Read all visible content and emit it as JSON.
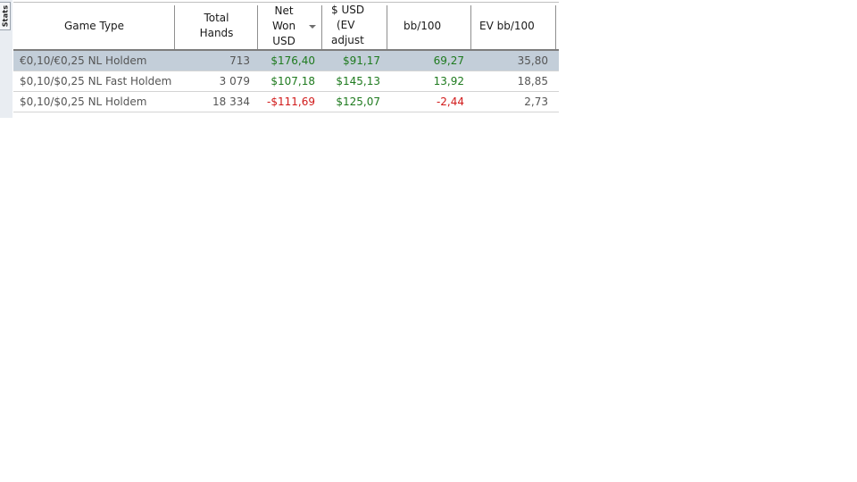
{
  "side_tab": {
    "label": "Stats"
  },
  "columns": {
    "game_type": "Game Type",
    "total_hands_line1": "Total",
    "total_hands_line2": "Hands",
    "net_won_line1": "Net",
    "net_won_line2": "Won",
    "net_won_line3": "USD",
    "usd_ev_line1": "$ USD",
    "usd_ev_line2": "(EV",
    "usd_ev_line3": "adjust",
    "bb100": "bb/100",
    "ev_bb100": "EV bb/100"
  },
  "sort": {
    "column": "net_won",
    "direction": "descending",
    "icon": "sort-down-icon"
  },
  "rows": [
    {
      "game_type": "€0,10/€0,25 NL Holdem",
      "total_hands": "713",
      "net_won": "$176,40",
      "usd_ev": "$91,17",
      "bb100": "69,27",
      "ev_bb100": "35,80",
      "selected": true
    },
    {
      "game_type": "$0,10/$0,25 NL Fast Holdem",
      "total_hands": "3 079",
      "net_won": "$107,18",
      "usd_ev": "$145,13",
      "bb100": "13,92",
      "ev_bb100": "18,85",
      "selected": false
    },
    {
      "game_type": "$0,10/$0,25 NL Holdem",
      "total_hands": "18 334",
      "net_won": "-$111,69",
      "usd_ev": "$125,07",
      "bb100": "-2,44",
      "ev_bb100": "2,73",
      "selected": false
    }
  ],
  "colors": {
    "positive": "#1e7a1e",
    "negative": "#d11a1a",
    "selected_row": "#c3ced9"
  }
}
